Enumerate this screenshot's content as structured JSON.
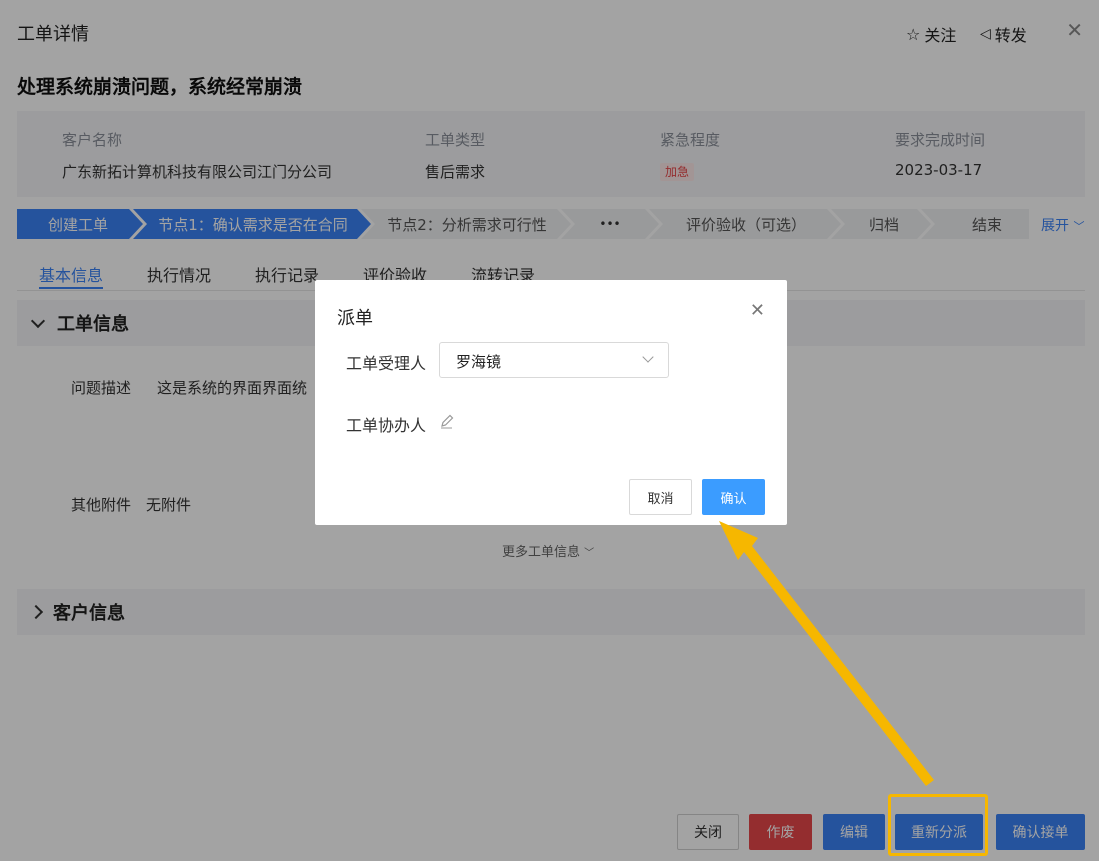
{
  "header": {
    "title": "工单详情",
    "follow_label": "关注",
    "forward_label": "转发"
  },
  "ticket": {
    "title": "处理系统崩溃问题，系统经常崩溃",
    "info": {
      "customer_label": "客户名称",
      "customer_value": "广东新拓计算机科技有限公司江门分公司",
      "type_label": "工单类型",
      "type_value": "售后需求",
      "urgency_label": "紧急程度",
      "urgency_value": "加急",
      "due_label": "要求完成时间",
      "due_value": "2023-03-17"
    }
  },
  "stepper": {
    "steps": [
      "创建工单",
      "节点1：确认需求是否在合同",
      "节点2：分析需求可行性",
      "•••",
      "评价验收（可选）",
      "归档",
      "结束"
    ],
    "expand_label": "展开"
  },
  "tabs": [
    "基本信息",
    "执行情况",
    "执行记录",
    "评价验收",
    "流转记录"
  ],
  "sections": {
    "ticket_info_title": "工单信息",
    "problem_label": "问题描述",
    "problem_value": "这是系统的界面界面统",
    "attachment_label": "其他附件",
    "attachment_value": "无附件",
    "more_info": "更多工单信息",
    "customer_info_title": "客户信息"
  },
  "footer_buttons": {
    "close": "关闭",
    "void": "作废",
    "edit": "编辑",
    "reassign": "重新分派",
    "confirm_accept": "确认接单"
  },
  "modal": {
    "title": "派单",
    "assignee_label": "工单受理人",
    "assignee_value": "罗海镜",
    "coassignee_label": "工单协办人",
    "cancel": "取消",
    "confirm": "确认"
  },
  "colors": {
    "primary": "#3b82f6",
    "danger": "#e8474a",
    "highlight": "#f6b700"
  }
}
